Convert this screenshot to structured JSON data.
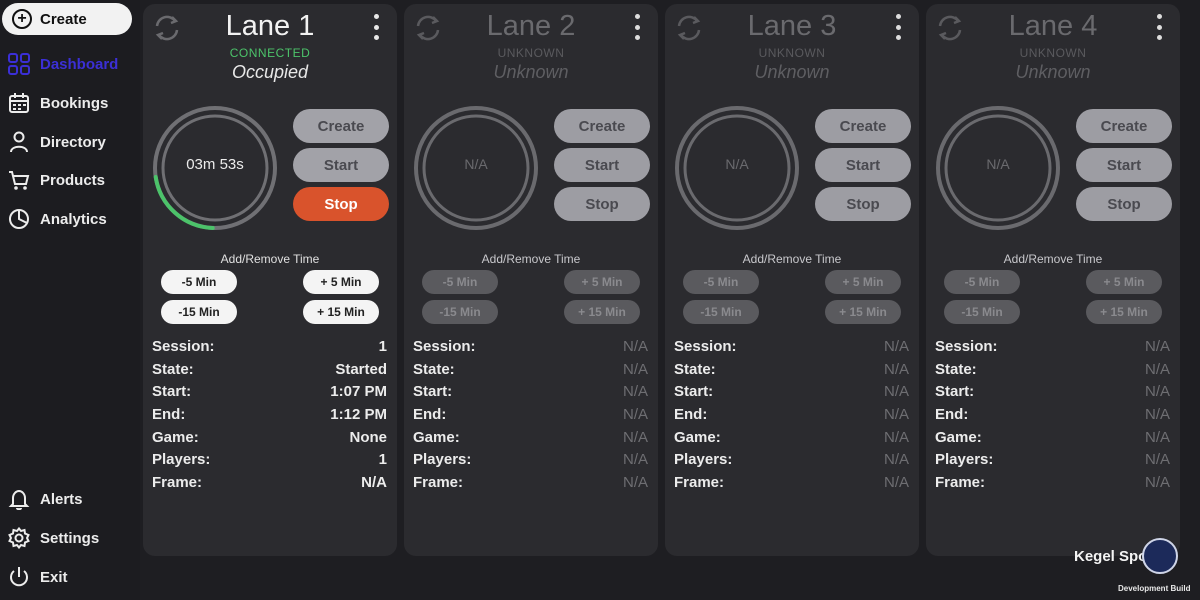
{
  "sidebar": {
    "create_label": "Create",
    "items": [
      {
        "label": "Dashboard",
        "icon": "dashboard-icon"
      },
      {
        "label": "Bookings",
        "icon": "calendar-icon"
      },
      {
        "label": "Directory",
        "icon": "person-icon"
      },
      {
        "label": "Products",
        "icon": "cart-icon"
      },
      {
        "label": "Analytics",
        "icon": "pie-chart-icon"
      }
    ],
    "bottom_items": [
      {
        "label": "Alerts",
        "icon": "bell-icon"
      },
      {
        "label": "Settings",
        "icon": "gear-icon"
      },
      {
        "label": "Exit",
        "icon": "power-icon"
      }
    ],
    "active_color": "#3b2fd6"
  },
  "lanes": [
    {
      "title": "Lane 1",
      "connection": "CONNECTED",
      "status": "Occupied",
      "timer": "03m 53s",
      "progress": 0.22,
      "buttons": {
        "create": "Create",
        "start": "Start",
        "stop": "Stop"
      },
      "time_label": "Add/Remove Time",
      "time_buttons": {
        "minus5": "-5 Min",
        "plus5": "+ 5 Min",
        "minus15": "-15 Min",
        "plus15": "+ 15 Min"
      },
      "info": [
        {
          "k": "Session:",
          "v": "1"
        },
        {
          "k": "State:",
          "v": "Started"
        },
        {
          "k": "Start:",
          "v": "1:07 PM"
        },
        {
          "k": "End:",
          "v": "1:12 PM"
        },
        {
          "k": "Game:",
          "v": "None"
        },
        {
          "k": "Players:",
          "v": "1"
        },
        {
          "k": "Frame:",
          "v": "N/A"
        }
      ]
    },
    {
      "title": "Lane 2",
      "connection": "UNKNOWN",
      "status": "Unknown",
      "timer": "N/A",
      "progress": 0,
      "buttons": {
        "create": "Create",
        "start": "Start",
        "stop": "Stop"
      },
      "time_label": "Add/Remove Time",
      "time_buttons": {
        "minus5": "-5 Min",
        "plus5": "+ 5 Min",
        "minus15": "-15 Min",
        "plus15": "+ 15 Min"
      },
      "info": [
        {
          "k": "Session:",
          "v": "N/A"
        },
        {
          "k": "State:",
          "v": "N/A"
        },
        {
          "k": "Start:",
          "v": "N/A"
        },
        {
          "k": "End:",
          "v": "N/A"
        },
        {
          "k": "Game:",
          "v": "N/A"
        },
        {
          "k": "Players:",
          "v": "N/A"
        },
        {
          "k": "Frame:",
          "v": "N/A"
        }
      ]
    },
    {
      "title": "Lane 3",
      "connection": "UNKNOWN",
      "status": "Unknown",
      "timer": "N/A",
      "progress": 0,
      "buttons": {
        "create": "Create",
        "start": "Start",
        "stop": "Stop"
      },
      "time_label": "Add/Remove Time",
      "time_buttons": {
        "minus5": "-5 Min",
        "plus5": "+ 5 Min",
        "minus15": "-15 Min",
        "plus15": "+ 15 Min"
      },
      "info": [
        {
          "k": "Session:",
          "v": "N/A"
        },
        {
          "k": "State:",
          "v": "N/A"
        },
        {
          "k": "Start:",
          "v": "N/A"
        },
        {
          "k": "End:",
          "v": "N/A"
        },
        {
          "k": "Game:",
          "v": "N/A"
        },
        {
          "k": "Players:",
          "v": "N/A"
        },
        {
          "k": "Frame:",
          "v": "N/A"
        }
      ]
    },
    {
      "title": "Lane 4",
      "connection": "UNKNOWN",
      "status": "Unknown",
      "timer": "N/A",
      "progress": 0,
      "buttons": {
        "create": "Create",
        "start": "Start",
        "stop": "Stop"
      },
      "time_label": "Add/Remove Time",
      "time_buttons": {
        "minus5": "-5 Min",
        "plus5": "+ 5 Min",
        "minus15": "-15 Min",
        "plus15": "+ 15 Min"
      },
      "info": [
        {
          "k": "Session:",
          "v": "N/A"
        },
        {
          "k": "State:",
          "v": "N/A"
        },
        {
          "k": "Start:",
          "v": "N/A"
        },
        {
          "k": "End:",
          "v": "N/A"
        },
        {
          "k": "Game:",
          "v": "N/A"
        },
        {
          "k": "Players:",
          "v": "N/A"
        },
        {
          "k": "Frame:",
          "v": "N/A"
        }
      ]
    }
  ],
  "brand": {
    "name": "Kegel Sport",
    "build": "Development Build"
  },
  "colors": {
    "connected": "#4cc36a",
    "stop_active": "#d9532c",
    "progress": "#4cc36a"
  }
}
